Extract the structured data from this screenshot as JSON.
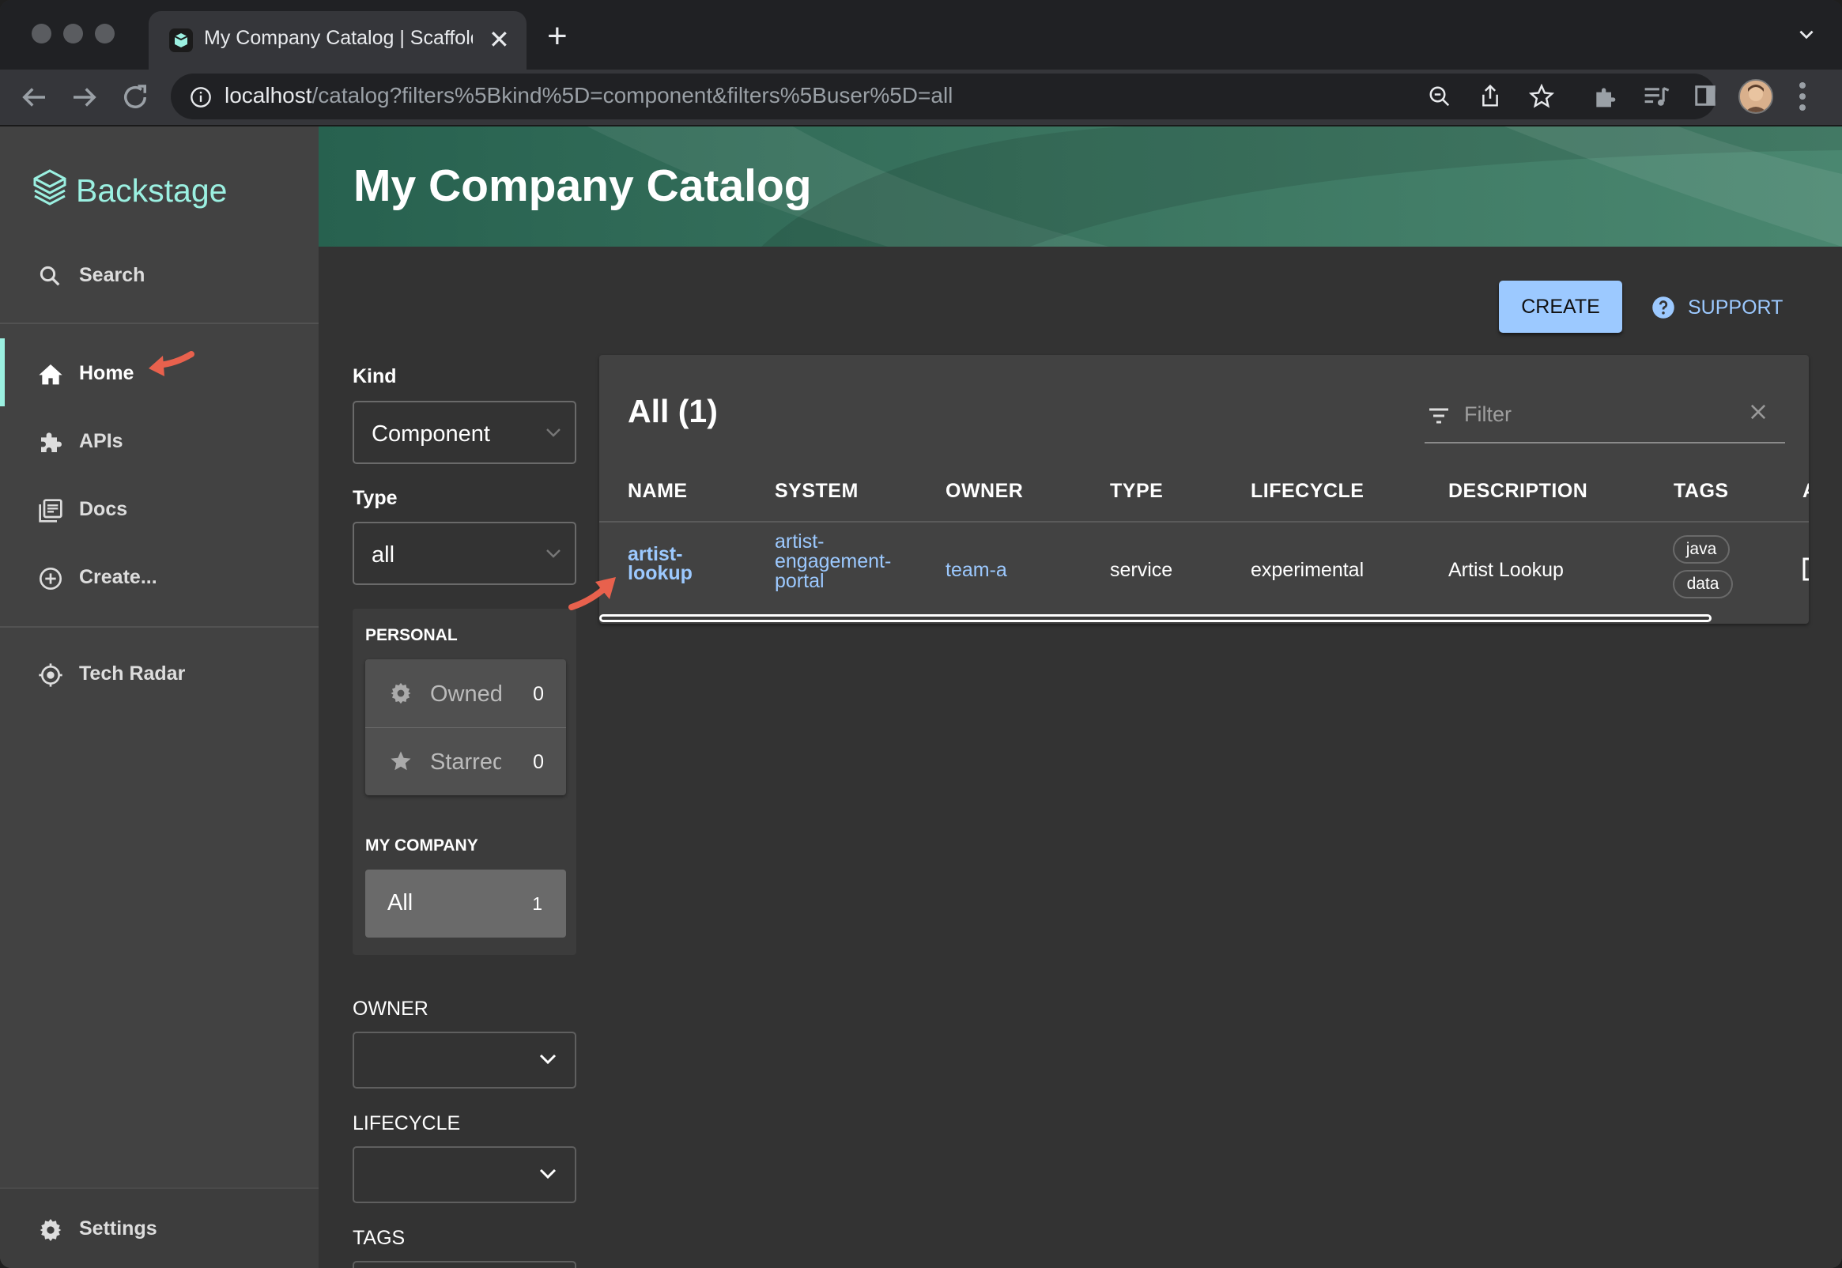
{
  "browser": {
    "tab_title": "My Company Catalog | Scaffolder",
    "url_host": "localhost",
    "url_path": "/catalog?filters%5Bkind%5D=component&filters%5Buser%5D=all"
  },
  "sidebar": {
    "brand": "Backstage",
    "search_label": "Search",
    "items": [
      {
        "label": "Home",
        "icon": "home-icon"
      },
      {
        "label": "APIs",
        "icon": "puzzle-icon"
      },
      {
        "label": "Docs",
        "icon": "library-icon"
      },
      {
        "label": "Create...",
        "icon": "add-circle-icon"
      }
    ],
    "tech_radar_label": "Tech Radar",
    "settings_label": "Settings",
    "accent": "#9BF0E1"
  },
  "header": {
    "title": "My Company Catalog"
  },
  "actions": {
    "create_label": "CREATE",
    "support_label": "SUPPORT"
  },
  "filters": {
    "kind_label": "Kind",
    "kind_value": "Component",
    "type_label": "Type",
    "type_value": "all",
    "personal_title": "PERSONAL",
    "owned_label": "Owned",
    "owned_count": "0",
    "starred_label": "Starred",
    "starred_count": "0",
    "company_title": "MY COMPANY",
    "all_label": "All",
    "all_count": "1",
    "owner_label": "OWNER",
    "lifecycle_label": "LIFECYCLE",
    "tags_label": "TAGS"
  },
  "table": {
    "title": "All (1)",
    "filter_placeholder": "Filter",
    "columns": [
      "NAME",
      "SYSTEM",
      "OWNER",
      "TYPE",
      "LIFECYCLE",
      "DESCRIPTION",
      "TAGS",
      "A"
    ],
    "row": {
      "name_line1": "artist-",
      "name_line2": "lookup",
      "system_line1": "artist-",
      "system_line2": "engagement-",
      "system_line3": "portal",
      "owner": "team-a",
      "type": "service",
      "lifecycle": "experimental",
      "description": "Artist Lookup",
      "tags": [
        "java",
        "data"
      ]
    }
  },
  "colors": {
    "link": "#9cc9ff",
    "annotation_arrow": "#e8614d",
    "header_gradient": "#27614f"
  }
}
